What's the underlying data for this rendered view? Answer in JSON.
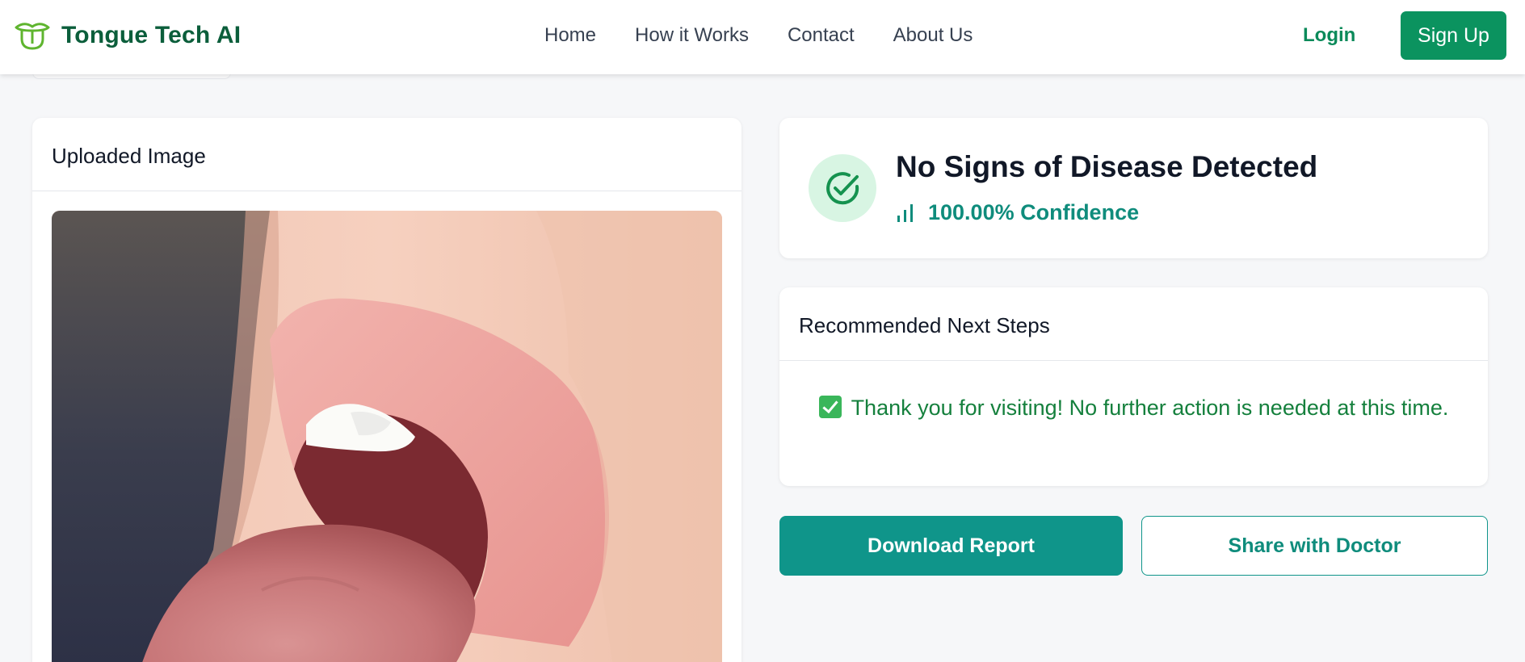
{
  "brand": {
    "name": "Tongue Tech AI",
    "logo_icon": "tongue-logo-icon"
  },
  "nav": {
    "links": [
      "Home",
      "How it Works",
      "Contact",
      "About Us"
    ],
    "login_label": "Login",
    "signup_label": "Sign Up"
  },
  "upload": {
    "title": "Uploaded Image"
  },
  "result": {
    "icon": "check-circle-icon",
    "title": "No Signs of Disease Detected",
    "confidence_text": "100.00% Confidence",
    "confidence_value": 100.0
  },
  "steps": {
    "title": "Recommended Next Steps",
    "message": "Thank you for visiting! No further action is needed at this time."
  },
  "actions": {
    "download_label": "Download Report",
    "share_label": "Share with Doctor"
  },
  "colors": {
    "brand": "#0b5e3b",
    "primary": "#0b935f",
    "teal": "#0f958a",
    "success_text": "#15803d",
    "background": "#f6f7f9"
  }
}
